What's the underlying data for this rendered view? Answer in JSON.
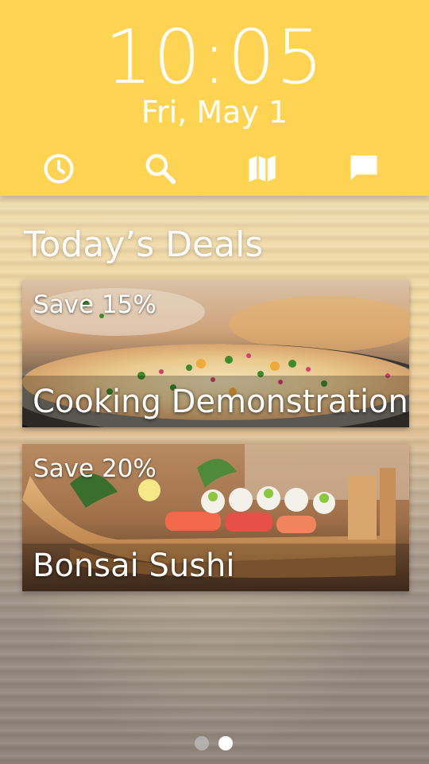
{
  "header": {
    "time": "10:05",
    "date": "Fri, May 1",
    "icons": [
      "clock-icon",
      "search-icon",
      "map-icon",
      "chat-icon"
    ],
    "background_color": "#ffd453"
  },
  "deals": {
    "title": "Today’s Deals",
    "items": [
      {
        "save": "Save 15%",
        "name": "Cooking Demonstration"
      },
      {
        "save": "Save 20%",
        "name": "Bonsai Sushi"
      }
    ]
  },
  "pager": {
    "page_count": 2,
    "active_page": 2
  }
}
